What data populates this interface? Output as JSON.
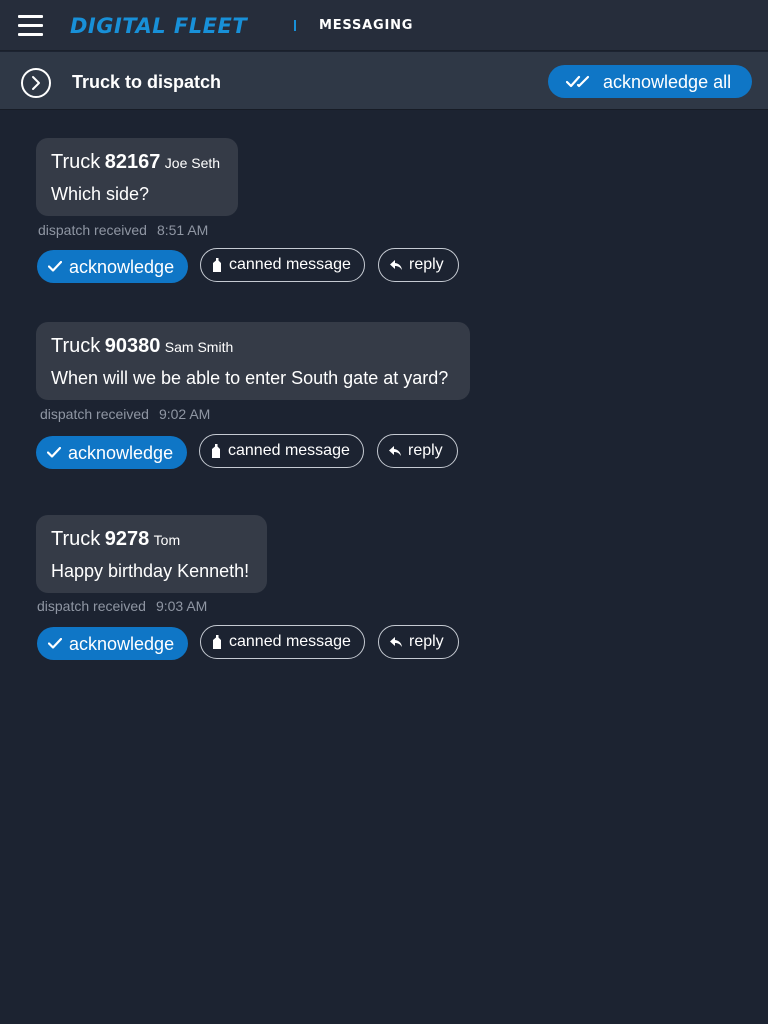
{
  "header": {
    "logo_text": "DIGITAL FLEET",
    "section": "MESSAGING",
    "brand_color": "#1890d8"
  },
  "conversation": {
    "title": "Truck to dispatch",
    "acknowledge_all_label": "acknowledge all"
  },
  "messages": [
    {
      "truck_word": "Truck",
      "truck_number": "82167",
      "driver": "Joe Seth",
      "text": "Which side?",
      "status": "dispatch received",
      "time": "8:51 AM"
    },
    {
      "truck_word": "Truck",
      "truck_number": "90380",
      "driver": "Sam Smith",
      "text": "When will we be able to enter South gate at yard?",
      "status": "dispatch received",
      "time": "9:02 AM"
    },
    {
      "truck_word": "Truck",
      "truck_number": "9278",
      "driver": "Tom",
      "text": "Happy birthday Kenneth!",
      "status": "dispatch received",
      "time": "9:03 AM"
    }
  ],
  "actions": {
    "acknowledge_label": "acknowledge",
    "canned_label": "canned message",
    "reply_label": "reply"
  },
  "colors": {
    "background": "#1c2331",
    "bubble": "#353b47",
    "accent": "#0f76c6",
    "meta_text": "#8f96a3"
  }
}
